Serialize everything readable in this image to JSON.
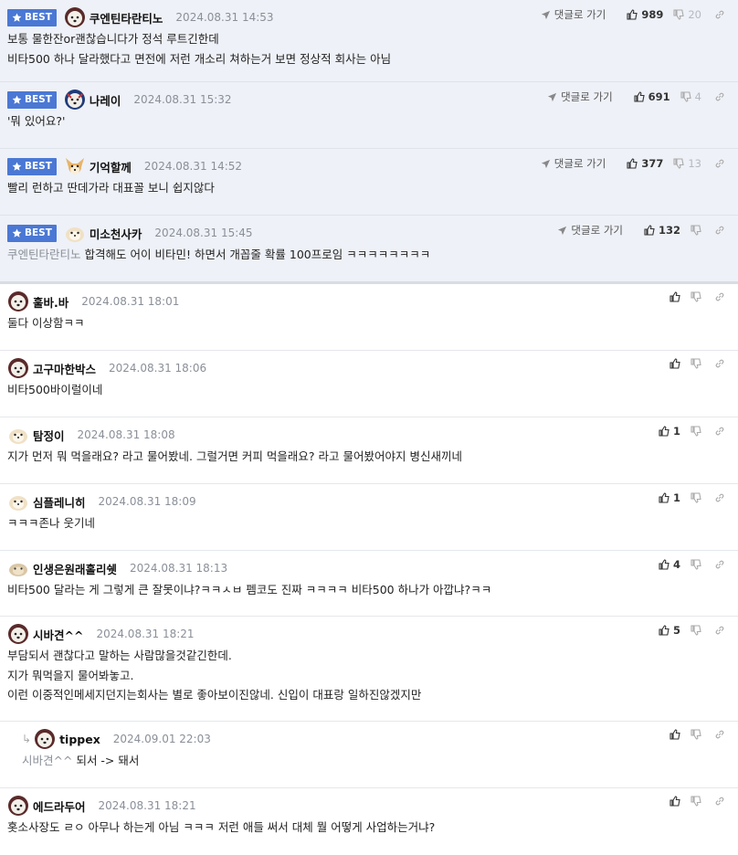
{
  "labels": {
    "best": "BEST",
    "goto": "댓글로 가기"
  },
  "best_comments": [
    {
      "nick": "쿠엔틴타란티노",
      "date": "2024.08.31 14:53",
      "lines": [
        "보통 물한잔or괜찮습니다가 정석 루트긴한데",
        "비타500 하나 달라했다고 면전에 저런 개소리 쳐하는거 보면 정상적 회사는 아님"
      ],
      "up": "989",
      "down": "20"
    },
    {
      "nick": "나레이",
      "date": "2024.08.31 15:32",
      "lines": [
        "'뭐 있어요?'"
      ],
      "up": "691",
      "down": "4"
    },
    {
      "nick": "기억할께",
      "date": "2024.08.31 14:52",
      "lines": [
        "빨리 런하고 딴데가라 대표꼴 보니 쉽지않다"
      ],
      "up": "377",
      "down": "13"
    },
    {
      "nick": "미소천사카",
      "date": "2024.08.31 15:45",
      "mention": "쿠엔틴타란티노",
      "lines": [
        "합격해도 어이 비타민! 하면서 개꼽줄 확률 100프로임 ㅋㅋㅋㅋㅋㅋㅋㅋ"
      ],
      "up": "132",
      "down": ""
    }
  ],
  "comments": [
    {
      "nick": "훌바.바",
      "date": "2024.08.31 18:01",
      "lines": [
        "둘다 이상함ㅋㅋ"
      ],
      "up": ""
    },
    {
      "nick": "고구마한박스",
      "date": "2024.08.31 18:06",
      "lines": [
        "비타500바이럴이네"
      ],
      "up": ""
    },
    {
      "nick": "탐정이",
      "date": "2024.08.31 18:08",
      "lines": [
        "지가 먼저 뭐 먹을래요? 라고 물어봤네. 그럴거면 커피 먹을래요? 라고 물어봤어야지 병신새끼네"
      ],
      "up": "1"
    },
    {
      "nick": "심플레니히",
      "date": "2024.08.31 18:09",
      "lines": [
        "ㅋㅋㅋ존나 웃기네"
      ],
      "up": "1"
    },
    {
      "nick": "인생은원래홀리쉣",
      "date": "2024.08.31 18:13",
      "lines": [
        "비타500 달라는 게 그렇게 큰 잘못이냐?ㅋㅋㅅㅂ 펨코도 진짜 ㅋㅋㅋㅋ 비타500 하나가 아깝냐?ㅋㅋ"
      ],
      "up": "4"
    },
    {
      "nick": "시바견^^",
      "date": "2024.08.31 18:21",
      "lines": [
        "부담되서 괜찮다고 말하는 사람많을것같긴한데.",
        "지가 뭐먹을지 물어봐놓고.",
        "이런 이중적인메세지던지는회사는 별로 좋아보이진않네. 신입이 대표랑 일하진않겠지만"
      ],
      "up": "5"
    },
    {
      "nick": "tippex",
      "date": "2024.09.01 22:03",
      "reply": true,
      "mention": "시바견^^",
      "lines": [
        "되서 -> 돼서"
      ],
      "up": ""
    },
    {
      "nick": "에드라두어",
      "date": "2024.08.31 18:21",
      "lines": [
        "홋소사장도 ㄹㅇ 아무나 하는게 아님 ㅋㅋㅋ 저런 애들 써서 대체 뭘 어떻게 사업하는거냐?"
      ],
      "up": ""
    }
  ],
  "colors": {
    "best_badge": "#4a78d4",
    "best_bg": "#eef1f7"
  }
}
